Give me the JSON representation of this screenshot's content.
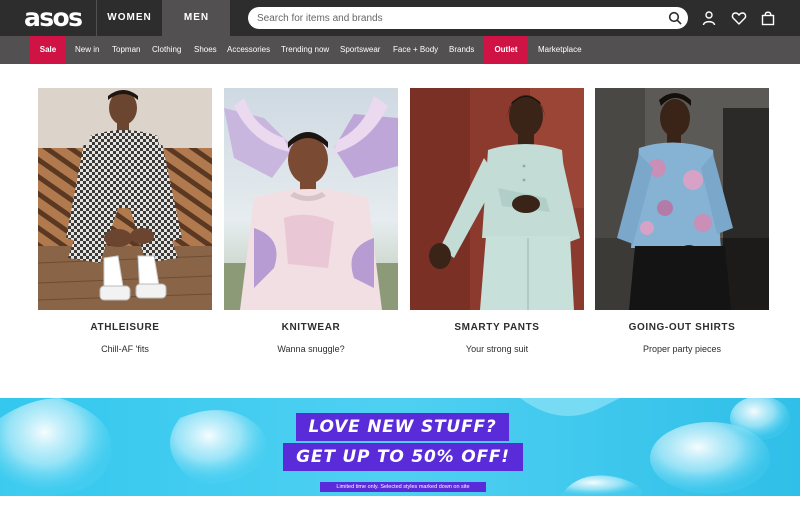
{
  "header": {
    "logo": "asos",
    "gender_tabs": [
      "WOMEN",
      "MEN"
    ],
    "active_gender": "MEN",
    "search": {
      "placeholder": "Search for items and brands",
      "value": ""
    },
    "icons": [
      "search-icon",
      "account-icon",
      "heart-icon",
      "bag-icon"
    ]
  },
  "nav": {
    "items": [
      "Sale",
      "New in",
      "Topman",
      "Clothing",
      "Shoes",
      "Accessories",
      "Trending now",
      "Sportswear",
      "Face + Body",
      "Brands",
      "Outlet",
      "Marketplace"
    ],
    "highlight_color": "#d01345"
  },
  "cards": [
    {
      "title": "ATHLEISURE",
      "subtitle": "Chill-AF 'fits"
    },
    {
      "title": "KNITWEAR",
      "subtitle": "Wanna snuggle?"
    },
    {
      "title": "SMARTY PANTS",
      "subtitle": "Your strong suit"
    },
    {
      "title": "GOING-OUT SHIRTS",
      "subtitle": "Proper party pieces"
    }
  ],
  "banner": {
    "line1": "LOVE NEW STUFF?",
    "line2": "GET UP TO 50% OFF!",
    "note": "Limited time only. Selected styles marked down on site"
  },
  "colors": {
    "header_bg": "#2d2d2d",
    "nav_bg": "#525050",
    "sale_red": "#d01345",
    "promo_purple": "#5a2bd9"
  }
}
